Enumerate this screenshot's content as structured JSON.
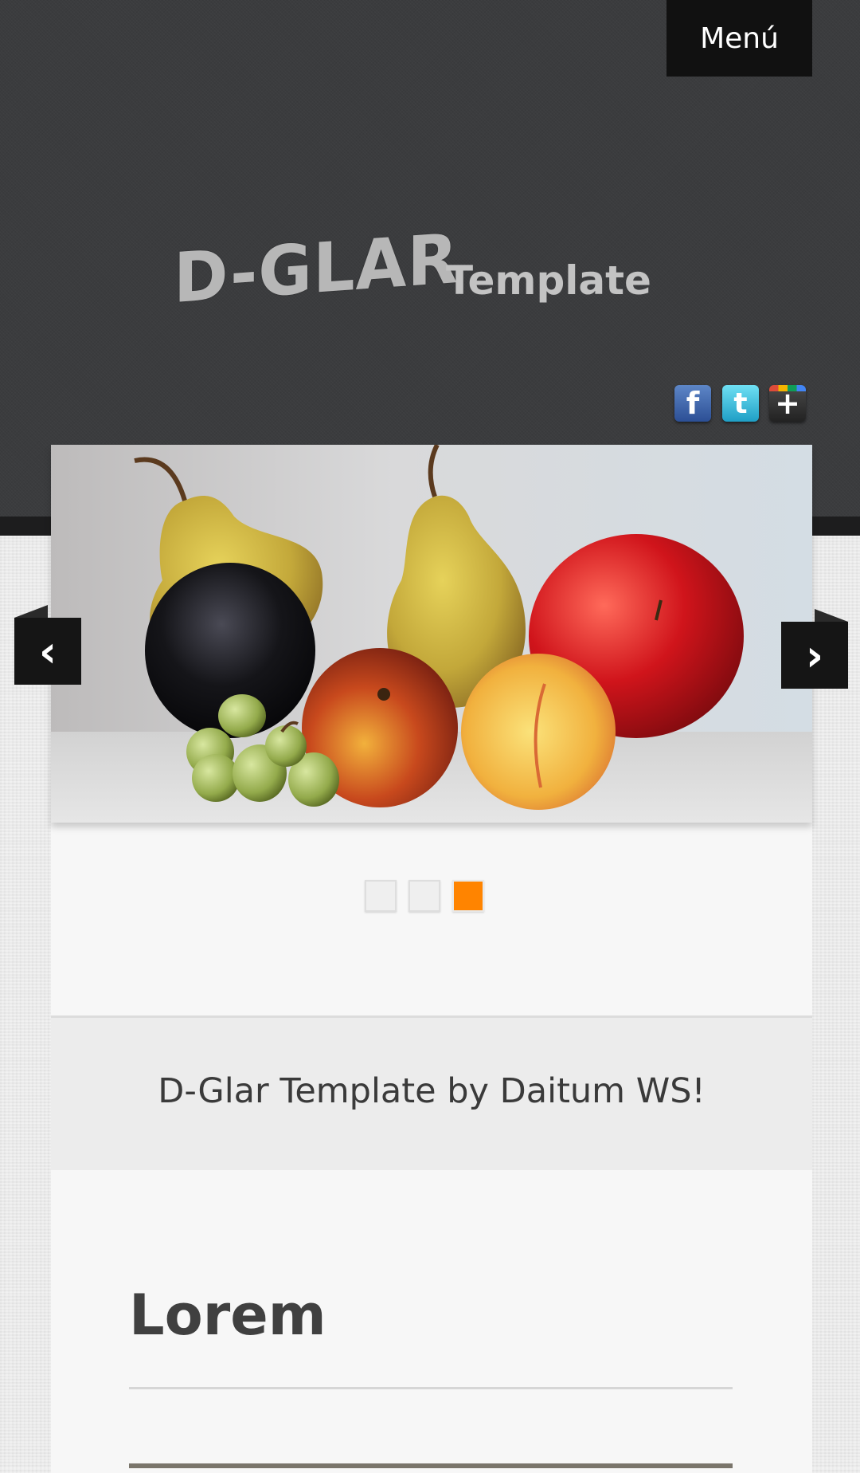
{
  "header": {
    "menu_label": "Menú",
    "logo_main": "D-GLAR",
    "logo_sub": "Template",
    "social": [
      {
        "name": "facebook",
        "glyph": "f",
        "color": "#3b5998"
      },
      {
        "name": "twitter",
        "glyph": "t",
        "color": "#29b6e0"
      },
      {
        "name": "google-plus",
        "glyph": "+",
        "color": "#333333"
      }
    ]
  },
  "slider": {
    "prev_glyph": "‹",
    "next_glyph": "›",
    "active_slide_index": 2,
    "slide_count": 3,
    "accent_color": "#ff8400",
    "image_subject": "fruit still-life painting"
  },
  "tagline": {
    "text": "D-Glar Template by Daitum WS!"
  },
  "article": {
    "title": "Lorem"
  }
}
